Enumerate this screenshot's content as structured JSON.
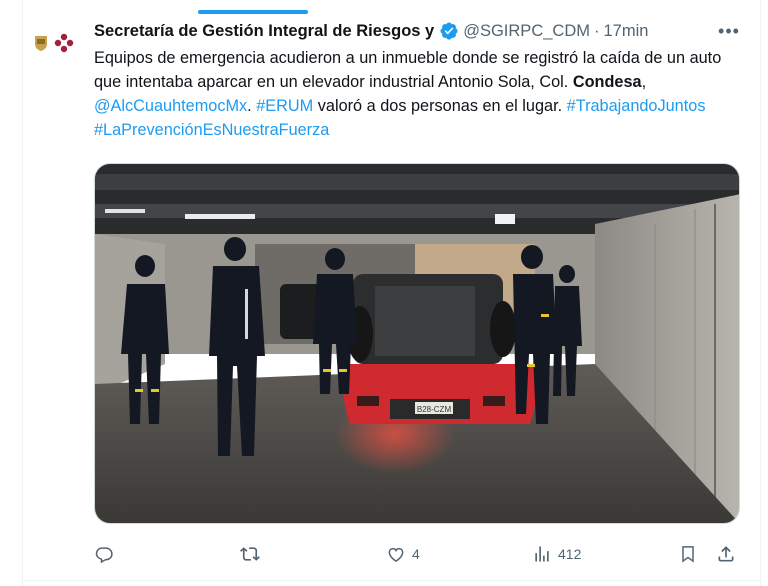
{
  "tweet": {
    "author_name": "Secretaría de Gestión Integral de Riesgos y",
    "handle": "@SGIRPC_CDM",
    "separator": "·",
    "time": "17min",
    "more_label": "•••",
    "text": {
      "part1": "Equipos de emergencia acudieron a un inmueble donde se registró la caída de un auto que intentaba aparcar en un elevador industrial Antonio Sola, Col. ",
      "bold": "Condesa",
      "part2": ", ",
      "mention": "@AlcCuauhtemocMx",
      "part3": ". ",
      "hashtag1": "#ERUM",
      "part4": " valoró a dos personas en el lugar. ",
      "hashtag2": "#TrabajandoJuntos",
      "part5": " ",
      "hashtag3": "#LaPrevenciónEsNuestraFuerza"
    },
    "media": {
      "plate_text": "B28-CZM"
    },
    "actions": {
      "reply_count": "",
      "retweet_count": "",
      "like_count": "4",
      "views_count": "412"
    }
  },
  "colors": {
    "accent": "#1d9bf0",
    "text": "#0f1419",
    "secondary": "#536471",
    "border": "#cfd9de"
  },
  "icons": [
    "verified-badge-icon",
    "reply-icon",
    "retweet-icon",
    "like-icon",
    "views-icon",
    "bookmark-icon",
    "share-icon",
    "more-icon"
  ]
}
